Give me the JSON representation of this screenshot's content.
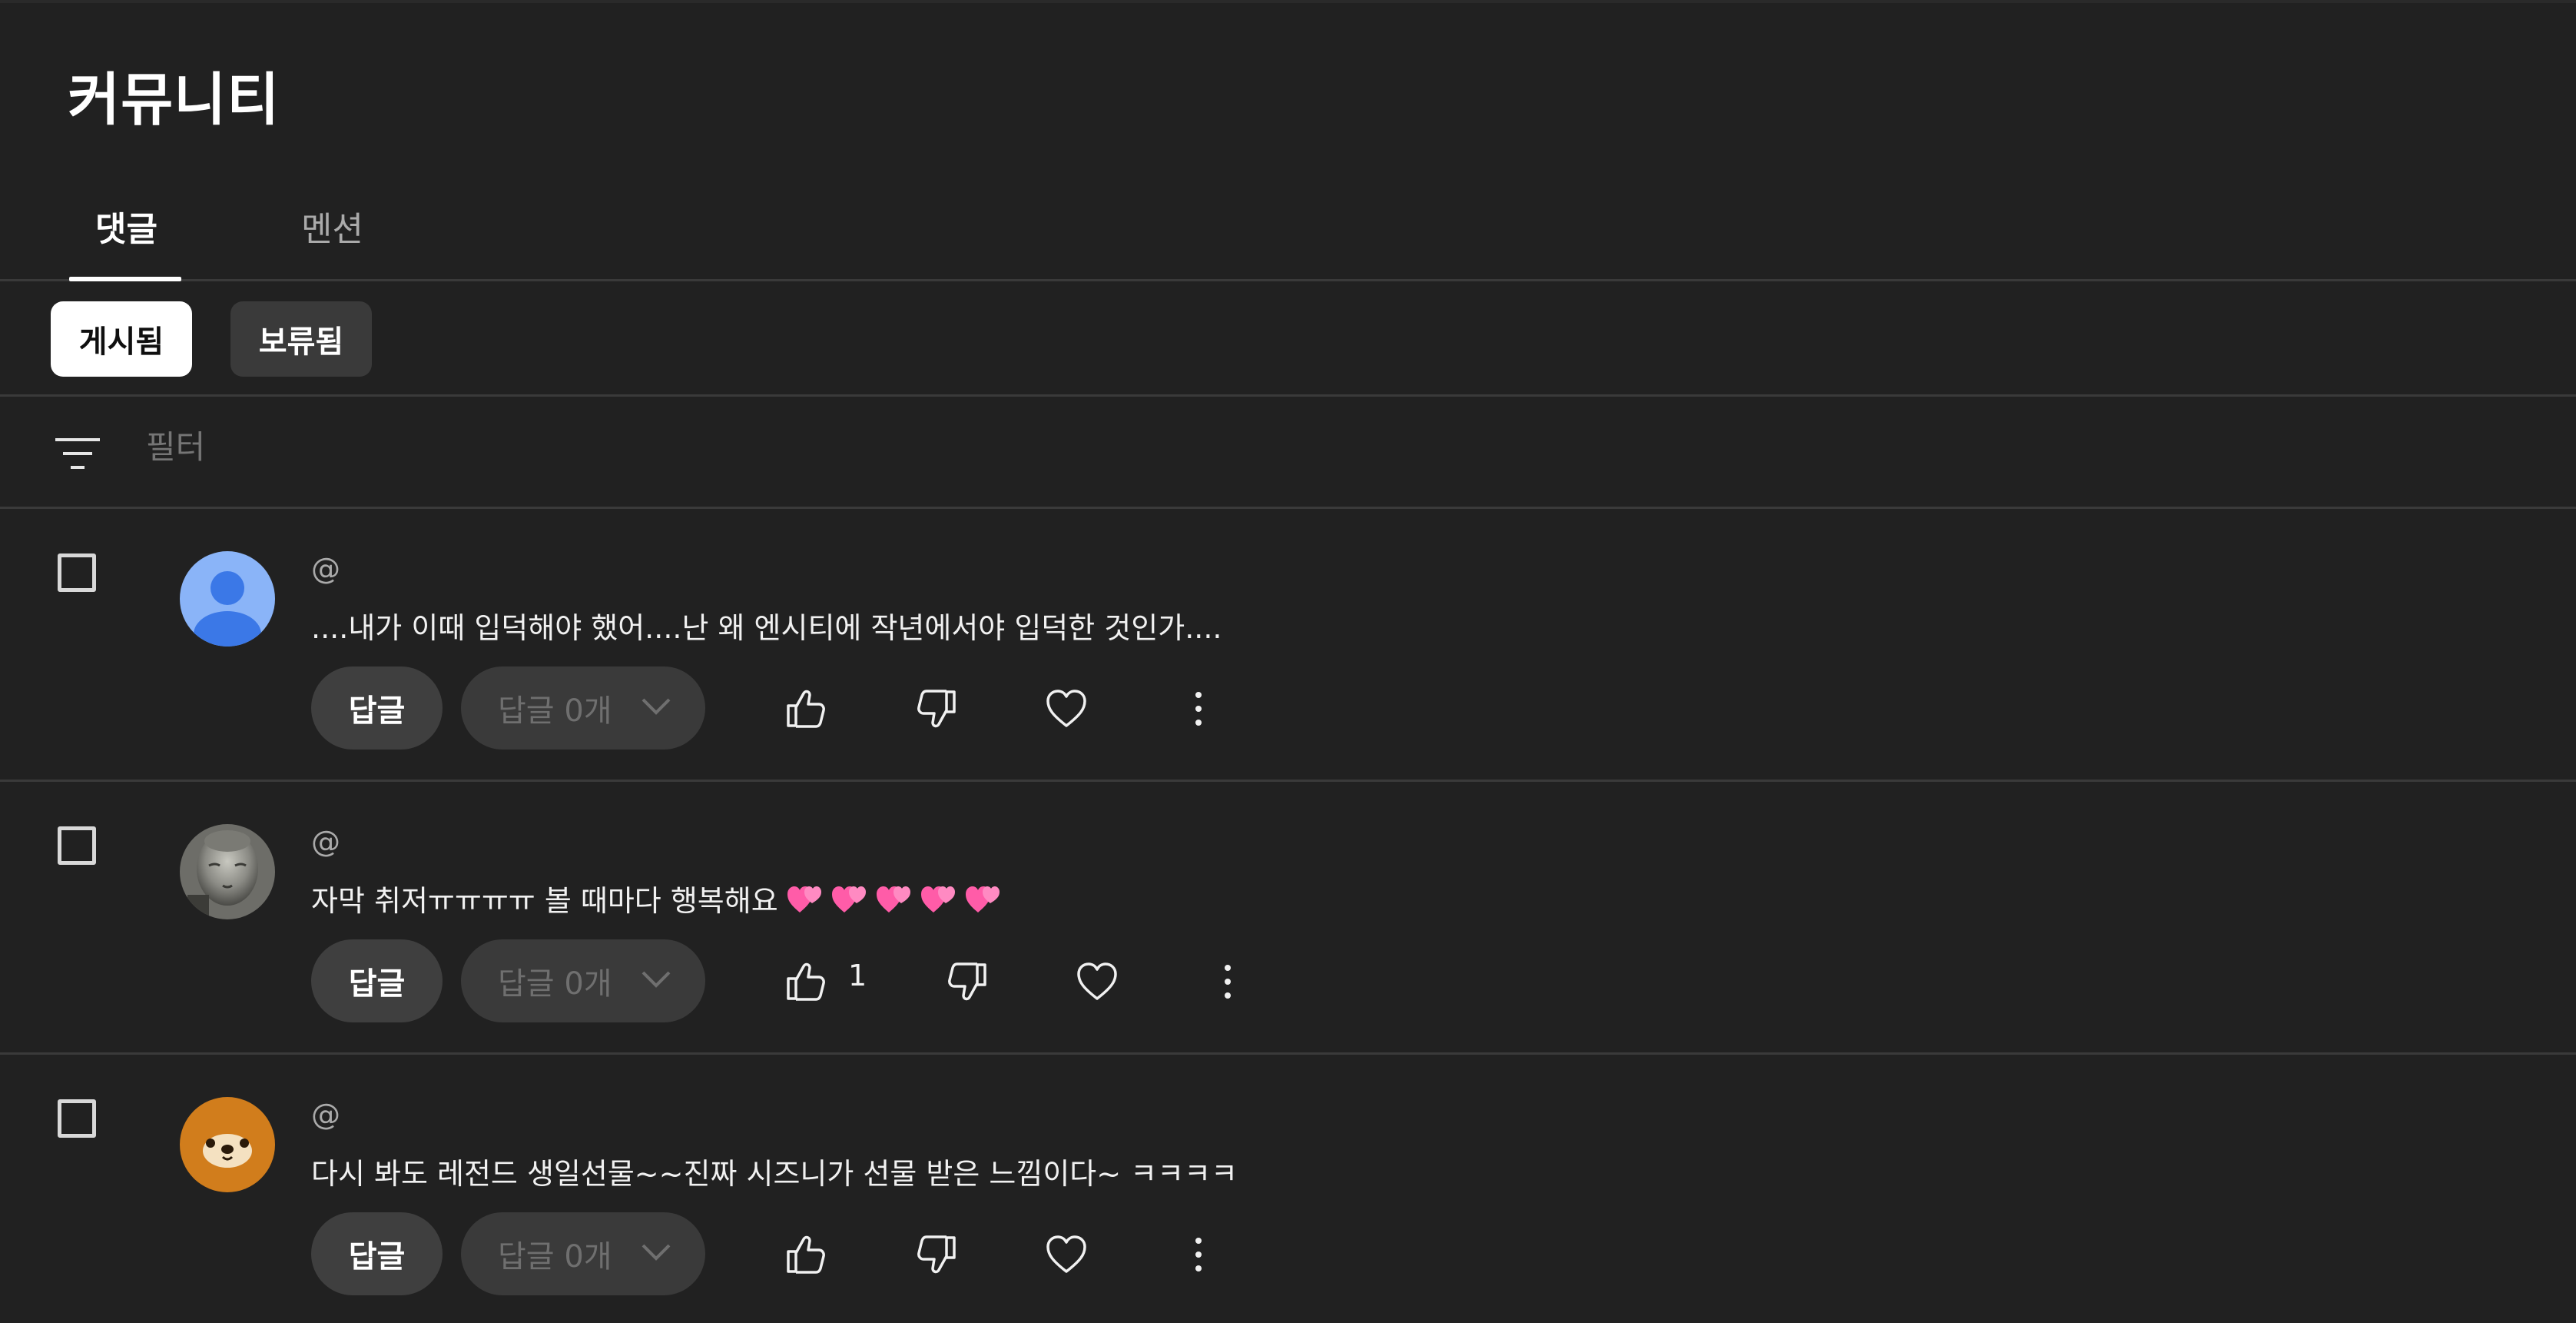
{
  "page": {
    "title": "커뮤니티"
  },
  "tabs": [
    {
      "label": "댓글",
      "active": true
    },
    {
      "label": "멘션",
      "active": false
    }
  ],
  "chips": [
    {
      "label": "게시됨",
      "selected": true
    },
    {
      "label": "보류됨",
      "selected": false
    }
  ],
  "filter": {
    "placeholder": "필터",
    "icon": "filter-icon"
  },
  "comments": [
    {
      "handle": "@",
      "text": "....내가 이때 입덕해야 했어....난 왜 엔시티에 작년에서야 입덕한 것인가....",
      "reply_label": "답글",
      "replies_label": "답글 0개",
      "like_count": "",
      "avatar": "default-user-avatar"
    },
    {
      "handle": "@",
      "text": "자막 취저ㅠㅠㅠㅠ 볼 때마다 행복해요",
      "emoji": "two-hearts",
      "emoji_count": 5,
      "reply_label": "답글",
      "replies_label": "답글 0개",
      "like_count": "1",
      "avatar": "statue-photo-avatar"
    },
    {
      "handle": "@",
      "text": "다시 봐도 레전드 생일선물~~진짜 시즈니가 선물 받은 느낌이다~ ㅋㅋㅋㅋ",
      "reply_label": "답글",
      "replies_label": "답글 0개",
      "like_count": "",
      "avatar": "bear-avatar"
    }
  ],
  "colors": {
    "background": "#212121",
    "divider": "#3a3a3a",
    "button": "#3f3f3f",
    "avatar_default": "#8ab4f8",
    "avatar_bear": "#d17d1c",
    "heart_emoji": "#ff5ca8"
  }
}
